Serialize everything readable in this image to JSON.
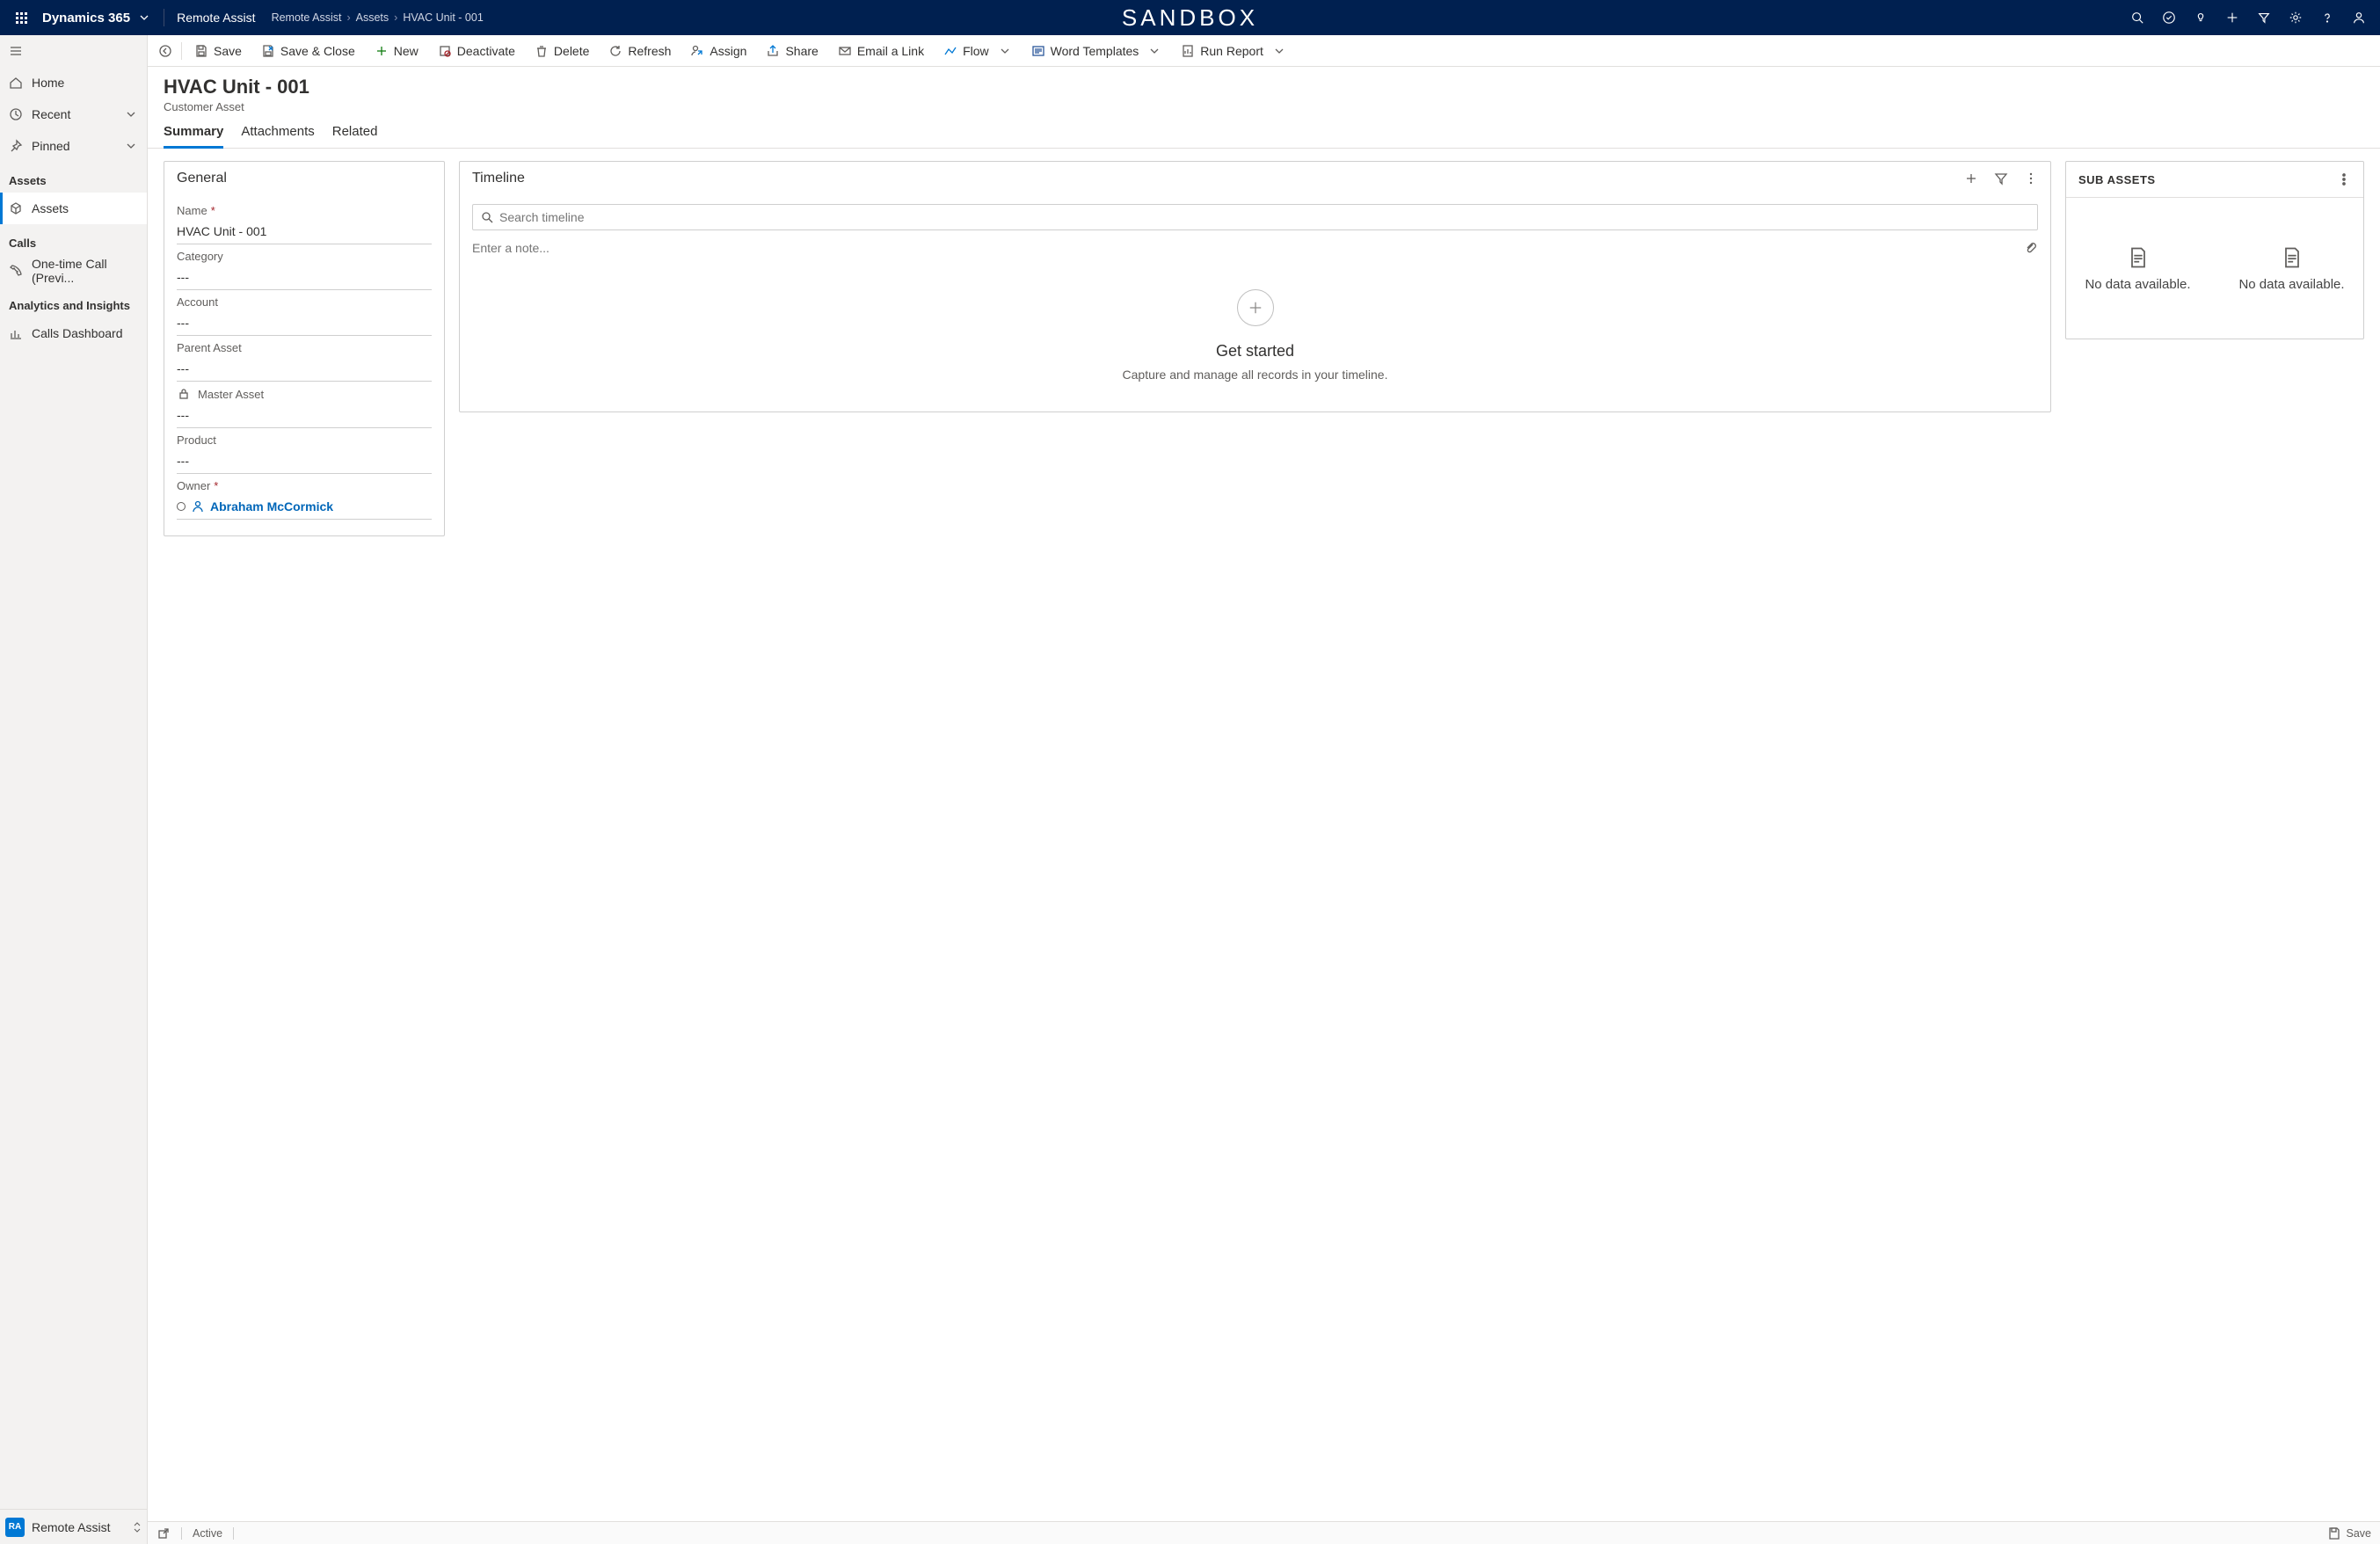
{
  "topbar": {
    "brand": "Dynamics 365",
    "app": "Remote Assist",
    "breadcrumbs": [
      "Remote Assist",
      "Assets",
      "HVAC Unit - 001"
    ],
    "env": "SANDBOX"
  },
  "leftnav": {
    "items_top": [
      {
        "icon": "home",
        "label": "Home"
      },
      {
        "icon": "clock",
        "label": "Recent",
        "expand": true
      },
      {
        "icon": "pin",
        "label": "Pinned",
        "expand": true
      }
    ],
    "groups": [
      {
        "label": "Assets",
        "items": [
          {
            "icon": "cube",
            "label": "Assets",
            "selected": true
          }
        ]
      },
      {
        "label": "Calls",
        "items": [
          {
            "icon": "phone",
            "label": "One-time Call (Previ..."
          }
        ]
      },
      {
        "label": "Analytics and Insights",
        "items": [
          {
            "icon": "chart",
            "label": "Calls Dashboard"
          }
        ]
      }
    ],
    "footer": {
      "badge": "RA",
      "label": "Remote Assist"
    }
  },
  "cmdbar": {
    "items": [
      {
        "icon": "save",
        "label": "Save"
      },
      {
        "icon": "saveclose",
        "label": "Save & Close"
      },
      {
        "icon": "plus-green",
        "label": "New"
      },
      {
        "icon": "deactivate",
        "label": "Deactivate"
      },
      {
        "icon": "delete",
        "label": "Delete"
      },
      {
        "icon": "refresh",
        "label": "Refresh"
      },
      {
        "icon": "assign",
        "label": "Assign"
      },
      {
        "icon": "share",
        "label": "Share"
      },
      {
        "icon": "email",
        "label": "Email a Link"
      },
      {
        "icon": "flow",
        "label": "Flow",
        "chev": true
      },
      {
        "icon": "word",
        "label": "Word Templates",
        "chev": true
      },
      {
        "icon": "report",
        "label": "Run Report",
        "chev": true
      }
    ]
  },
  "header": {
    "title": "HVAC Unit - 001",
    "subtitle": "Customer Asset"
  },
  "tabs": [
    {
      "label": "Summary",
      "active": true
    },
    {
      "label": "Attachments"
    },
    {
      "label": "Related"
    }
  ],
  "general": {
    "title": "General",
    "fields": {
      "name": {
        "label": "Name",
        "required": true,
        "value": "HVAC Unit - 001"
      },
      "category": {
        "label": "Category",
        "value": "---"
      },
      "account": {
        "label": "Account",
        "value": "---"
      },
      "parent": {
        "label": "Parent Asset",
        "value": "---"
      },
      "master": {
        "label": "Master Asset",
        "locked": true,
        "value": "---"
      },
      "product": {
        "label": "Product",
        "value": "---"
      },
      "owner": {
        "label": "Owner",
        "required": true,
        "value": "Abraham McCormick"
      }
    }
  },
  "timeline": {
    "title": "Timeline",
    "search_placeholder": "Search timeline",
    "note_placeholder": "Enter a note...",
    "empty_title": "Get started",
    "empty_desc": "Capture and manage all records in your timeline."
  },
  "subassets": {
    "title": "SUB ASSETS",
    "nodata": "No data available."
  },
  "status": {
    "state": "Active",
    "save": "Save"
  }
}
